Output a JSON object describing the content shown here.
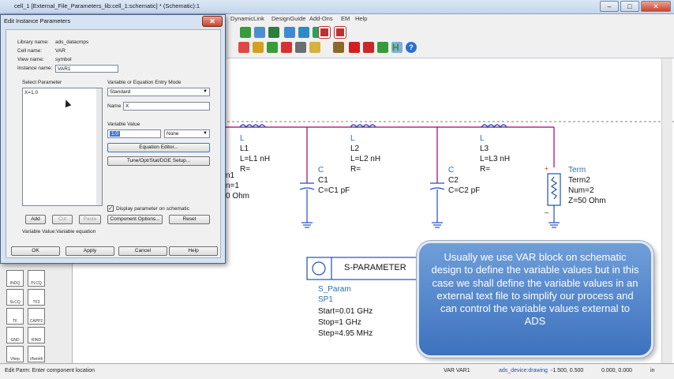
{
  "window": {
    "title": "cell_1 [External_File_Parameters_lib:cell_1:schematic] * (Schematic):1"
  },
  "menubar": {
    "items": [
      "DynamicLink",
      "DesignGuide",
      "Add-Ons",
      "EM",
      "Help"
    ]
  },
  "dialog": {
    "title": "Edit Instance Parameters",
    "close_label": "✕",
    "library_label": "Library name:",
    "library_value": "ads_datacmps",
    "cell_label": "Cell name:",
    "cell_value": "VAR",
    "view_label": "View name:",
    "view_value": "symbol",
    "instance_label": "Instance name:",
    "instance_value": "VAR1",
    "select_param_label": "Select Parameter",
    "params": [
      "X=1.0"
    ],
    "mode_label": "Variable or Equation Entry Mode",
    "mode_value": "Standard",
    "name_label": "Name",
    "name_value": "X",
    "value_label": "Variable Value",
    "value_value": "1.0",
    "unit_value": "None",
    "equation_editor": "Equation Editor...",
    "tune_setup": "Tune/Opt/Stat/DOE Setup...",
    "add": "Add",
    "cut": "Cut",
    "paste": "Paste",
    "display_checkbox": "Display parameter on schematic",
    "component_options": "Component Options...",
    "reset": "Reset",
    "status": "Variable Value:Variable equation",
    "ok": "OK",
    "apply": "Apply",
    "cancel": "Cancel",
    "help": "Help"
  },
  "schematic": {
    "L1": {
      "type": "L",
      "name": "L1",
      "value": "L=L1 nH",
      "r": "R="
    },
    "L2": {
      "type": "L",
      "name": "L2",
      "value": "L=L2 nH",
      "r": "R="
    },
    "L3": {
      "type": "L",
      "name": "L3",
      "value": "L=L3 nH",
      "r": "R="
    },
    "C1": {
      "type": "C",
      "name": "C1",
      "value": "C=C1 pF"
    },
    "C2": {
      "type": "C",
      "name": "C2",
      "value": "C=C2 pF"
    },
    "Term2": {
      "type": "Term",
      "name": "Term2",
      "num": "Num=2",
      "z": "Z=50 Ohm"
    },
    "Term1_partial": {
      "name": "n1",
      "num": "n=1",
      "z": "0 Ohm"
    },
    "sparam": {
      "header": "S-PARAMETER",
      "type": "S_Param",
      "name": "SP1",
      "start": "Start=0.01 GHz",
      "stop": "Stop=1 GHz",
      "step": "Step=4.95 MHz"
    }
  },
  "palette": [
    "INDQ",
    "PLCQ",
    "SLCQ",
    "TF3",
    "TF",
    "CAPP2",
    "GND",
    "RIND",
    "Vferp",
    "Vfwrnth"
  ],
  "statusbar": {
    "left": "Edit Parm: Enter component location",
    "instance": "VAR VAR1",
    "context": "ads_device:drawing",
    "coords": "-1.500, 0.500",
    "coords2": "0.000, 0.000",
    "unit": "in"
  },
  "callout": {
    "text": "Usually we use VAR block on schematic design to define the variable values but in this case we shall define the variable values in an external text file to simplify our process and can control the variable values external to ADS"
  },
  "colors": {
    "wire": "#a0006e",
    "component": "#1f4fbf",
    "label": "#2a6fb0",
    "dialog_bg": "#f0f0f0",
    "callout": "#4f83c9"
  }
}
